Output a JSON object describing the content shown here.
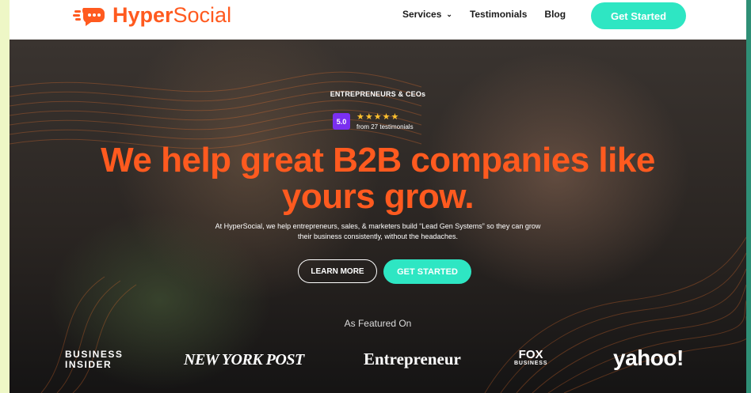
{
  "header": {
    "brand": {
      "bold": "Hyper",
      "light": "Social"
    },
    "nav": [
      {
        "label": "Services"
      },
      {
        "label": "Testimonials"
      },
      {
        "label": "Blog"
      }
    ],
    "cta": "Get Started"
  },
  "hero": {
    "eyebrow": "ENTREPRENEURS & CEOs",
    "rating": {
      "score": "5.0",
      "stars": "★★★★★",
      "count_text": "from 27 testimonials"
    },
    "headline_line1": "We help great B2B companies like",
    "headline_line2": "yours grow.",
    "subtext": "At HyperSocial, we help entrepreneurs, sales, & marketers build “Lead Gen Systems” so they can grow their business consistently, without the headaches.",
    "learn_more": "LEARN MORE",
    "get_started": "GET STARTED",
    "featured_title": "As Featured On",
    "press": {
      "business_insider_1": "BUSINESS",
      "business_insider_2": "INSIDER",
      "nypost": "NEW YORK POST",
      "entrepreneur": "Entrepreneur",
      "fox_1": "FOX",
      "fox_2": "BUSINESS",
      "yahoo": "yahoo!"
    }
  },
  "colors": {
    "brand_orange": "#ff5a1f",
    "cta_teal": "#2ee6c3",
    "rating_purple": "#7a2ff0",
    "star_gold": "#ffc12e"
  }
}
